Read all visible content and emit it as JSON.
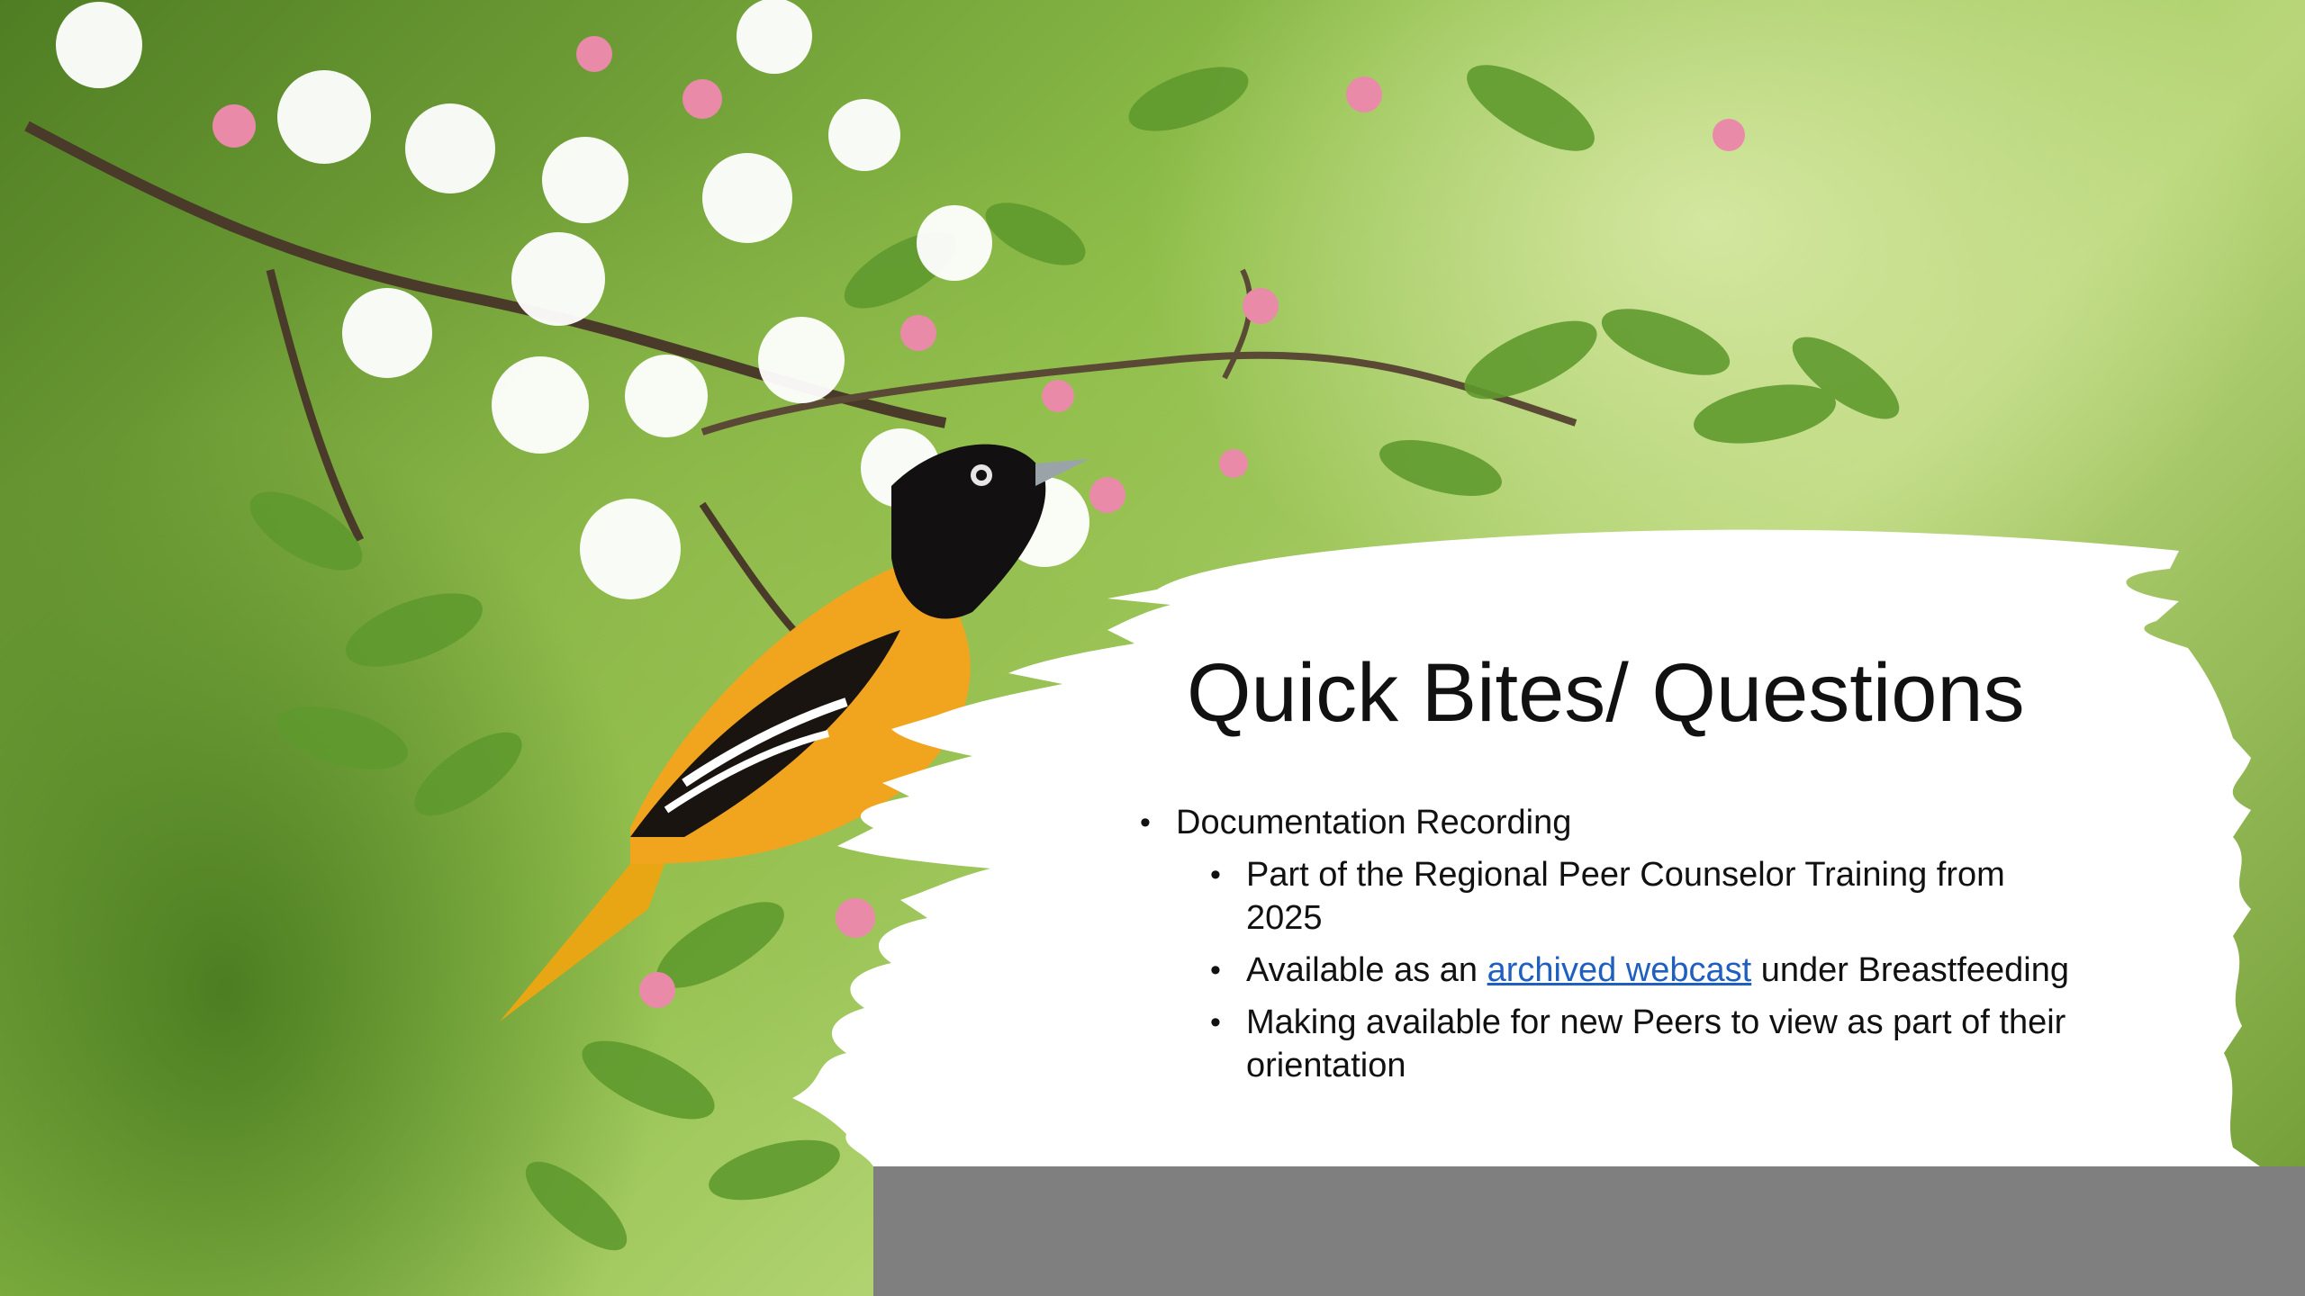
{
  "slide": {
    "title": "Quick Bites/ Questions",
    "bullets": [
      {
        "level": 1,
        "text": "Documentation Recording"
      },
      {
        "level": 2,
        "text": "Part of the Regional Peer Counselor Training from 2025"
      },
      {
        "level": 2,
        "before": "Available as an ",
        "link": "archived webcast",
        "after": " under Breastfeeding"
      },
      {
        "level": 2,
        "text": "Making available for new Peers to view as part of their orientation"
      }
    ]
  },
  "colors": {
    "text": "#111111",
    "link": "#1f5fbf",
    "panel": "#ffffff",
    "band": "#7f7f7f",
    "background": "#8fbf4a"
  }
}
